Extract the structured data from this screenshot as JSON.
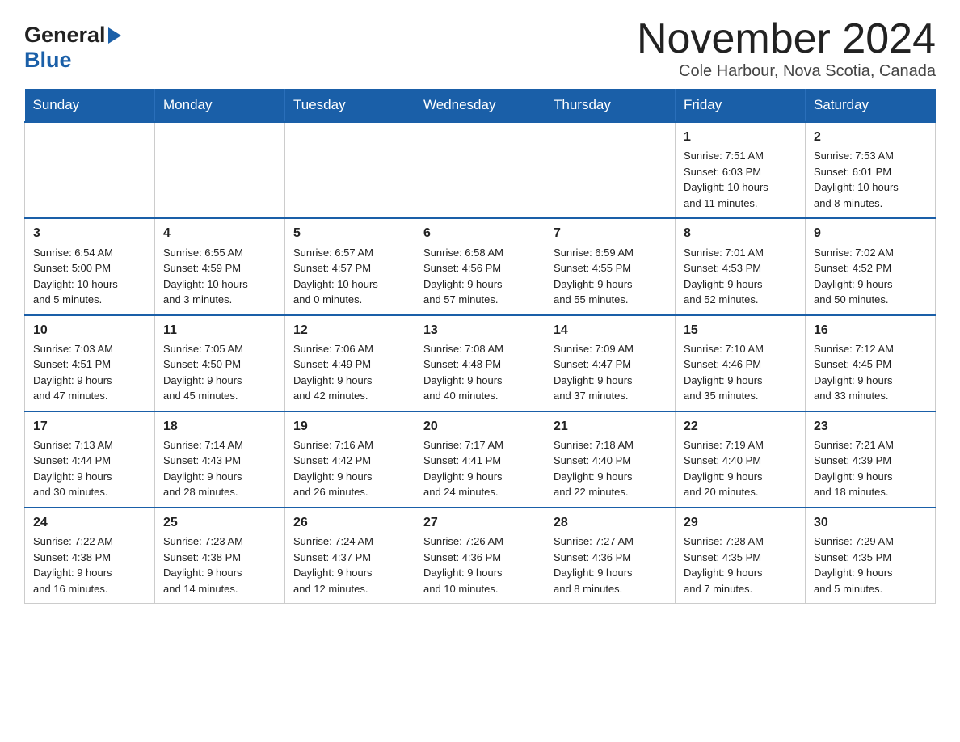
{
  "header": {
    "title": "November 2024",
    "subtitle": "Cole Harbour, Nova Scotia, Canada",
    "logo_general": "General",
    "logo_blue": "Blue"
  },
  "days_of_week": [
    "Sunday",
    "Monday",
    "Tuesday",
    "Wednesday",
    "Thursday",
    "Friday",
    "Saturday"
  ],
  "weeks": [
    {
      "days": [
        {
          "num": "",
          "info": ""
        },
        {
          "num": "",
          "info": ""
        },
        {
          "num": "",
          "info": ""
        },
        {
          "num": "",
          "info": ""
        },
        {
          "num": "",
          "info": ""
        },
        {
          "num": "1",
          "info": "Sunrise: 7:51 AM\nSunset: 6:03 PM\nDaylight: 10 hours\nand 11 minutes."
        },
        {
          "num": "2",
          "info": "Sunrise: 7:53 AM\nSunset: 6:01 PM\nDaylight: 10 hours\nand 8 minutes."
        }
      ]
    },
    {
      "days": [
        {
          "num": "3",
          "info": "Sunrise: 6:54 AM\nSunset: 5:00 PM\nDaylight: 10 hours\nand 5 minutes."
        },
        {
          "num": "4",
          "info": "Sunrise: 6:55 AM\nSunset: 4:59 PM\nDaylight: 10 hours\nand 3 minutes."
        },
        {
          "num": "5",
          "info": "Sunrise: 6:57 AM\nSunset: 4:57 PM\nDaylight: 10 hours\nand 0 minutes."
        },
        {
          "num": "6",
          "info": "Sunrise: 6:58 AM\nSunset: 4:56 PM\nDaylight: 9 hours\nand 57 minutes."
        },
        {
          "num": "7",
          "info": "Sunrise: 6:59 AM\nSunset: 4:55 PM\nDaylight: 9 hours\nand 55 minutes."
        },
        {
          "num": "8",
          "info": "Sunrise: 7:01 AM\nSunset: 4:53 PM\nDaylight: 9 hours\nand 52 minutes."
        },
        {
          "num": "9",
          "info": "Sunrise: 7:02 AM\nSunset: 4:52 PM\nDaylight: 9 hours\nand 50 minutes."
        }
      ]
    },
    {
      "days": [
        {
          "num": "10",
          "info": "Sunrise: 7:03 AM\nSunset: 4:51 PM\nDaylight: 9 hours\nand 47 minutes."
        },
        {
          "num": "11",
          "info": "Sunrise: 7:05 AM\nSunset: 4:50 PM\nDaylight: 9 hours\nand 45 minutes."
        },
        {
          "num": "12",
          "info": "Sunrise: 7:06 AM\nSunset: 4:49 PM\nDaylight: 9 hours\nand 42 minutes."
        },
        {
          "num": "13",
          "info": "Sunrise: 7:08 AM\nSunset: 4:48 PM\nDaylight: 9 hours\nand 40 minutes."
        },
        {
          "num": "14",
          "info": "Sunrise: 7:09 AM\nSunset: 4:47 PM\nDaylight: 9 hours\nand 37 minutes."
        },
        {
          "num": "15",
          "info": "Sunrise: 7:10 AM\nSunset: 4:46 PM\nDaylight: 9 hours\nand 35 minutes."
        },
        {
          "num": "16",
          "info": "Sunrise: 7:12 AM\nSunset: 4:45 PM\nDaylight: 9 hours\nand 33 minutes."
        }
      ]
    },
    {
      "days": [
        {
          "num": "17",
          "info": "Sunrise: 7:13 AM\nSunset: 4:44 PM\nDaylight: 9 hours\nand 30 minutes."
        },
        {
          "num": "18",
          "info": "Sunrise: 7:14 AM\nSunset: 4:43 PM\nDaylight: 9 hours\nand 28 minutes."
        },
        {
          "num": "19",
          "info": "Sunrise: 7:16 AM\nSunset: 4:42 PM\nDaylight: 9 hours\nand 26 minutes."
        },
        {
          "num": "20",
          "info": "Sunrise: 7:17 AM\nSunset: 4:41 PM\nDaylight: 9 hours\nand 24 minutes."
        },
        {
          "num": "21",
          "info": "Sunrise: 7:18 AM\nSunset: 4:40 PM\nDaylight: 9 hours\nand 22 minutes."
        },
        {
          "num": "22",
          "info": "Sunrise: 7:19 AM\nSunset: 4:40 PM\nDaylight: 9 hours\nand 20 minutes."
        },
        {
          "num": "23",
          "info": "Sunrise: 7:21 AM\nSunset: 4:39 PM\nDaylight: 9 hours\nand 18 minutes."
        }
      ]
    },
    {
      "days": [
        {
          "num": "24",
          "info": "Sunrise: 7:22 AM\nSunset: 4:38 PM\nDaylight: 9 hours\nand 16 minutes."
        },
        {
          "num": "25",
          "info": "Sunrise: 7:23 AM\nSunset: 4:38 PM\nDaylight: 9 hours\nand 14 minutes."
        },
        {
          "num": "26",
          "info": "Sunrise: 7:24 AM\nSunset: 4:37 PM\nDaylight: 9 hours\nand 12 minutes."
        },
        {
          "num": "27",
          "info": "Sunrise: 7:26 AM\nSunset: 4:36 PM\nDaylight: 9 hours\nand 10 minutes."
        },
        {
          "num": "28",
          "info": "Sunrise: 7:27 AM\nSunset: 4:36 PM\nDaylight: 9 hours\nand 8 minutes."
        },
        {
          "num": "29",
          "info": "Sunrise: 7:28 AM\nSunset: 4:35 PM\nDaylight: 9 hours\nand 7 minutes."
        },
        {
          "num": "30",
          "info": "Sunrise: 7:29 AM\nSunset: 4:35 PM\nDaylight: 9 hours\nand 5 minutes."
        }
      ]
    }
  ]
}
